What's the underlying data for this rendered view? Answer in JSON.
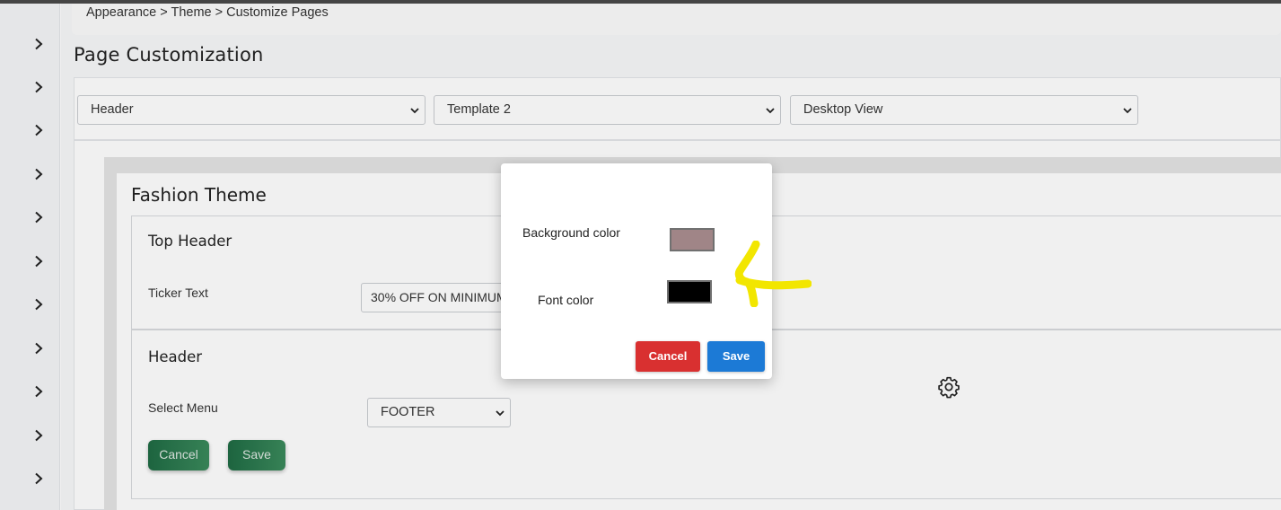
{
  "breadcrumb": {
    "text": "Appearance > Theme > Customize Pages"
  },
  "page": {
    "title": "Page Customization"
  },
  "filters": {
    "section_select": "Header",
    "template_select": "Template 2",
    "view_select": "Desktop View"
  },
  "theme": {
    "title": "Fashion Theme",
    "top_header": {
      "title": "Top Header",
      "ticker_label": "Ticker Text",
      "ticker_value": "30% OFF ON MINIMUM"
    },
    "header": {
      "title": "Header",
      "menu_label": "Select Menu",
      "menu_value": "FOOTER",
      "cancel_label": "Cancel",
      "save_label": "Save"
    }
  },
  "modal": {
    "bg_label": "Background color",
    "bg_color": "#a08587",
    "font_label": "Font color",
    "font_color": "#000000",
    "cancel_label": "Cancel",
    "save_label": "Save"
  },
  "colors": {
    "cancel_red": "#d93030",
    "save_blue": "#1c7ad6",
    "annotation_yellow": "#f2e600"
  },
  "icons": {
    "sidebar": "chevron-right-icon",
    "settings": "gear-icon",
    "dropdown": "chevron-down-icon"
  }
}
